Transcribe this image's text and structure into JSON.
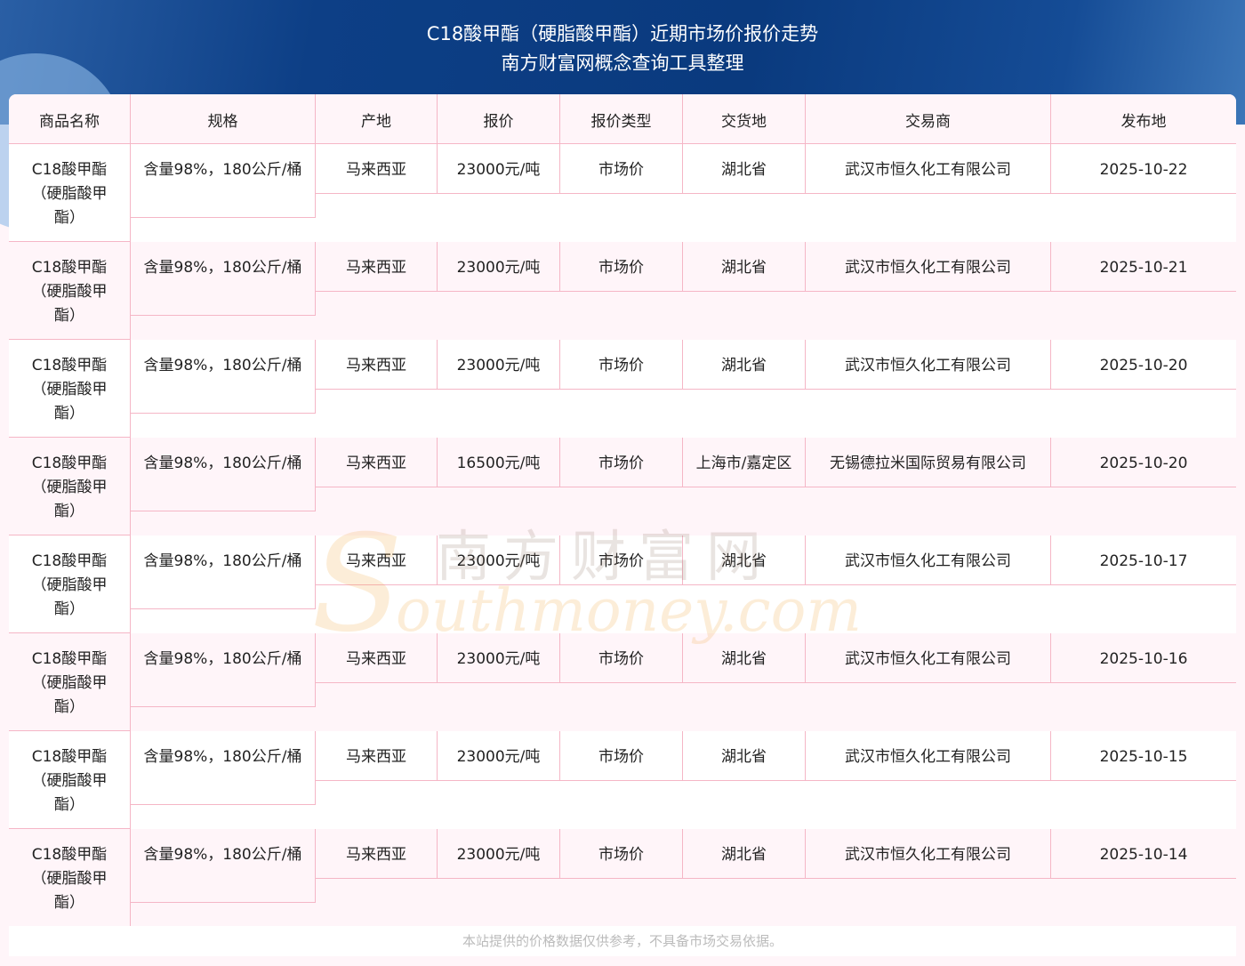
{
  "header": {
    "title": "C18酸甲酯（硬脂酸甲酯）近期市场价报价走势",
    "subtitle": "南方财富网概念查询工具整理"
  },
  "columns": [
    "商品名称",
    "规格",
    "产地",
    "报价",
    "报价类型",
    "交货地",
    "交易商",
    "发布地"
  ],
  "rows": [
    [
      "C18酸甲酯（硬脂酸甲酯）",
      "含量98%，180公斤/桶",
      "马来西亚",
      "23000元/吨",
      "市场价",
      "湖北省",
      "武汉市恒久化工有限公司",
      "2025-10-22"
    ],
    [
      "C18酸甲酯（硬脂酸甲酯）",
      "含量98%，180公斤/桶",
      "马来西亚",
      "23000元/吨",
      "市场价",
      "湖北省",
      "武汉市恒久化工有限公司",
      "2025-10-21"
    ],
    [
      "C18酸甲酯（硬脂酸甲酯）",
      "含量98%，180公斤/桶",
      "马来西亚",
      "23000元/吨",
      "市场价",
      "湖北省",
      "武汉市恒久化工有限公司",
      "2025-10-20"
    ],
    [
      "C18酸甲酯（硬脂酸甲酯）",
      "含量98%，180公斤/桶",
      "马来西亚",
      "16500元/吨",
      "市场价",
      "上海市/嘉定区",
      "无锡德拉米国际贸易有限公司",
      "2025-10-20"
    ],
    [
      "C18酸甲酯（硬脂酸甲酯）",
      "含量98%，180公斤/桶",
      "马来西亚",
      "23000元/吨",
      "市场价",
      "湖北省",
      "武汉市恒久化工有限公司",
      "2025-10-17"
    ],
    [
      "C18酸甲酯（硬脂酸甲酯）",
      "含量98%，180公斤/桶",
      "马来西亚",
      "23000元/吨",
      "市场价",
      "湖北省",
      "武汉市恒久化工有限公司",
      "2025-10-16"
    ],
    [
      "C18酸甲酯（硬脂酸甲酯）",
      "含量98%，180公斤/桶",
      "马来西亚",
      "23000元/吨",
      "市场价",
      "湖北省",
      "武汉市恒久化工有限公司",
      "2025-10-15"
    ],
    [
      "C18酸甲酯（硬脂酸甲酯）",
      "含量98%，180公斤/桶",
      "马来西亚",
      "23000元/吨",
      "市场价",
      "湖北省",
      "武汉市恒久化工有限公司",
      "2025-10-14"
    ]
  ],
  "footer": "本站提供的价格数据仅供参考，不具备市场交易依据。",
  "watermark": {
    "cn": "南方财富网",
    "en": "outhmoney.com",
    "s": "S"
  },
  "colors": {
    "border": "#f5b6c6",
    "row_alt": "#fff5f9",
    "header_bg": "#0d3f86"
  }
}
